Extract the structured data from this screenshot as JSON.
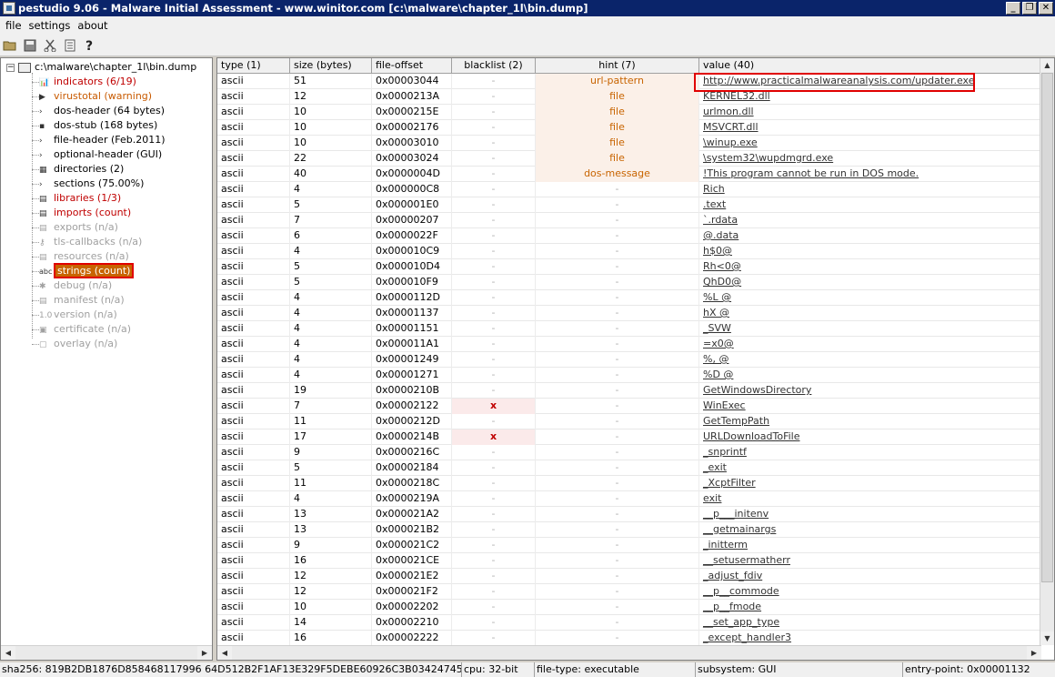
{
  "window": {
    "title": "pestudio 9.06 - Malware Initial Assessment - www.winitor.com [c:\\malware\\chapter_1l\\bin.dump]",
    "controls": [
      "_",
      "❐",
      "✕"
    ]
  },
  "menu": [
    "file",
    "settings",
    "about"
  ],
  "tree": {
    "root": "c:\\malware\\chapter_1l\\bin.dump",
    "items": [
      {
        "label": "indicators (6/19)",
        "icon": "bar-chart-icon",
        "style": "red"
      },
      {
        "label": "virustotal (warning)",
        "icon": "virustotal-icon",
        "style": "orange"
      },
      {
        "label": "dos-header (64 bytes)",
        "icon": "arrow-icon",
        "style": "normal"
      },
      {
        "label": "dos-stub (168 bytes)",
        "icon": "console-icon",
        "style": "normal"
      },
      {
        "label": "file-header (Feb.2011)",
        "icon": "arrow-icon",
        "style": "normal"
      },
      {
        "label": "optional-header (GUI)",
        "icon": "arrow-icon",
        "style": "normal"
      },
      {
        "label": "directories (2)",
        "icon": "grid-icon",
        "style": "normal"
      },
      {
        "label": "sections (75.00%)",
        "icon": "arrow-icon",
        "style": "normal"
      },
      {
        "label": "libraries (1/3)",
        "icon": "library-icon",
        "style": "red"
      },
      {
        "label": "imports (count)",
        "icon": "imports-icon",
        "style": "red"
      },
      {
        "label": "exports (n/a)",
        "icon": "exports-icon",
        "style": "gray"
      },
      {
        "label": "tls-callbacks (n/a)",
        "icon": "key-icon",
        "style": "gray"
      },
      {
        "label": "resources (n/a)",
        "icon": "resources-icon",
        "style": "gray"
      },
      {
        "label": "strings (count)",
        "icon": "abc-icon",
        "style": "selected"
      },
      {
        "label": "debug (n/a)",
        "icon": "bug-icon",
        "style": "gray"
      },
      {
        "label": "manifest (n/a)",
        "icon": "manifest-icon",
        "style": "gray"
      },
      {
        "label": "version (n/a)",
        "icon": "version-icon",
        "style": "gray"
      },
      {
        "label": "certificate (n/a)",
        "icon": "certificate-icon",
        "style": "gray"
      },
      {
        "label": "overlay (n/a)",
        "icon": "overlay-icon",
        "style": "gray"
      }
    ]
  },
  "table": {
    "headers": [
      "type (1)",
      "size (bytes)",
      "file-offset",
      "blacklist (2)",
      "hint (7)",
      "value (40)"
    ],
    "rows": [
      [
        "ascii",
        "51",
        "0x00003044",
        "-",
        "url-pattern",
        "http://www.practicalmalwareanalysis.com/updater.exe"
      ],
      [
        "ascii",
        "12",
        "0x0000213A",
        "-",
        "file",
        "KERNEL32.dll"
      ],
      [
        "ascii",
        "10",
        "0x0000215E",
        "-",
        "file",
        "urlmon.dll"
      ],
      [
        "ascii",
        "10",
        "0x00002176",
        "-",
        "file",
        "MSVCRT.dll"
      ],
      [
        "ascii",
        "10",
        "0x00003010",
        "-",
        "file",
        "\\winup.exe"
      ],
      [
        "ascii",
        "22",
        "0x00003024",
        "-",
        "file",
        "\\system32\\wupdmgrd.exe"
      ],
      [
        "ascii",
        "40",
        "0x0000004D",
        "-",
        "dos-message",
        "!This program cannot be run in DOS mode."
      ],
      [
        "ascii",
        "4",
        "0x000000C8",
        "-",
        "-",
        "Rich"
      ],
      [
        "ascii",
        "5",
        "0x000001E0",
        "-",
        "-",
        ".text"
      ],
      [
        "ascii",
        "7",
        "0x00000207",
        "-",
        "-",
        "`.rdata"
      ],
      [
        "ascii",
        "6",
        "0x0000022F",
        "-",
        "-",
        "@.data"
      ],
      [
        "ascii",
        "4",
        "0x000010C9",
        "-",
        "-",
        "h$0@"
      ],
      [
        "ascii",
        "5",
        "0x000010D4",
        "-",
        "-",
        "Rh<0@"
      ],
      [
        "ascii",
        "5",
        "0x000010F9",
        "-",
        "-",
        "QhD0@"
      ],
      [
        "ascii",
        "4",
        "0x0000112D",
        "-",
        "-",
        "%L @"
      ],
      [
        "ascii",
        "4",
        "0x00001137",
        "-",
        "-",
        "hX @"
      ],
      [
        "ascii",
        "4",
        "0x00001151",
        "-",
        "-",
        "_SVW"
      ],
      [
        "ascii",
        "4",
        "0x000011A1",
        "-",
        "-",
        "=x0@"
      ],
      [
        "ascii",
        "4",
        "0x00001249",
        "-",
        "-",
        "%, @"
      ],
      [
        "ascii",
        "4",
        "0x00001271",
        "-",
        "-",
        "%D @"
      ],
      [
        "ascii",
        "19",
        "0x0000210B",
        "-",
        "-",
        "GetWindowsDirectory"
      ],
      [
        "ascii",
        "7",
        "0x00002122",
        "x",
        "-",
        "WinExec"
      ],
      [
        "ascii",
        "11",
        "0x0000212D",
        "-",
        "-",
        "GetTempPath"
      ],
      [
        "ascii",
        "17",
        "0x0000214B",
        "x",
        "-",
        "URLDownloadToFile"
      ],
      [
        "ascii",
        "9",
        "0x0000216C",
        "-",
        "-",
        "_snprintf"
      ],
      [
        "ascii",
        "5",
        "0x00002184",
        "-",
        "-",
        "_exit"
      ],
      [
        "ascii",
        "11",
        "0x0000218C",
        "-",
        "-",
        "_XcptFilter"
      ],
      [
        "ascii",
        "4",
        "0x0000219A",
        "-",
        "-",
        "exit"
      ],
      [
        "ascii",
        "13",
        "0x000021A2",
        "-",
        "-",
        "__p___initenv"
      ],
      [
        "ascii",
        "13",
        "0x000021B2",
        "-",
        "-",
        "__getmainargs"
      ],
      [
        "ascii",
        "9",
        "0x000021C2",
        "-",
        "-",
        "_initterm"
      ],
      [
        "ascii",
        "16",
        "0x000021CE",
        "-",
        "-",
        "__setusermatherr"
      ],
      [
        "ascii",
        "12",
        "0x000021E2",
        "-",
        "-",
        "_adjust_fdiv"
      ],
      [
        "ascii",
        "12",
        "0x000021F2",
        "-",
        "-",
        "__p__commode"
      ],
      [
        "ascii",
        "10",
        "0x00002202",
        "-",
        "-",
        "__p__fmode"
      ],
      [
        "ascii",
        "14",
        "0x00002210",
        "-",
        "-",
        "__set_app_type"
      ],
      [
        "ascii",
        "16",
        "0x00002222",
        "-",
        "-",
        "_except_handler3"
      ]
    ]
  },
  "status": {
    "sha256": "sha256: 819B2DB1876D858468117996 64D512B2F1AF13E329F5DEBE60926C3B03424745",
    "cpu": "cpu: 32-bit",
    "filetype": "file-type: executable",
    "subsystem": "subsystem: GUI",
    "entrypoint": "entry-point: 0x00001132"
  },
  "colors": {
    "titlebar": "#0a246a",
    "alert_red": "#c00000",
    "hint_orange": "#c86400",
    "highlight_box": "#e00000"
  }
}
